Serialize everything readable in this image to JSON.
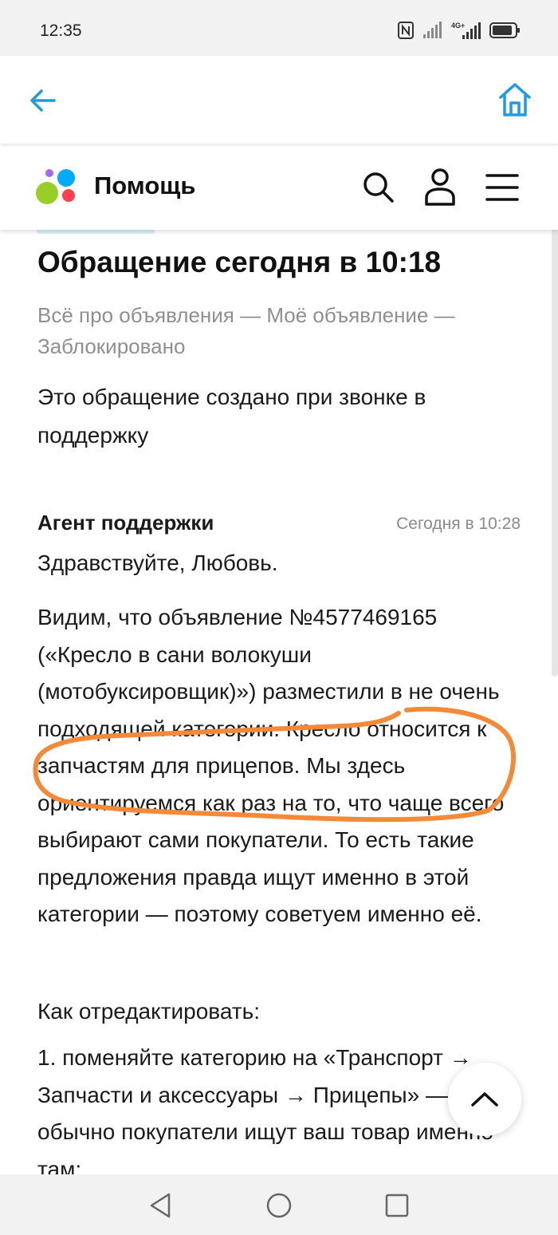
{
  "status": {
    "time": "12:35",
    "network": "4G+",
    "icons": [
      "nfc-icon",
      "signal-icon",
      "signal-4g-icon",
      "battery-icon"
    ]
  },
  "browser": {
    "back_icon": "arrow-left-icon",
    "home_icon": "home-icon",
    "accent": "#1e9be0"
  },
  "header": {
    "title": "Помощь",
    "icons": [
      "search-icon",
      "user-icon",
      "menu-icon"
    ],
    "logo_colors": [
      "#97cf26",
      "#a169f7",
      "#00aaff",
      "#ff4053"
    ]
  },
  "appeal": {
    "title": "Обращение сегодня в 10:18",
    "breadcrumb": "Всё про объявления — Моё объявление — Заблокировано",
    "note": "Это обращение создано при звонке в поддержку"
  },
  "message": {
    "author": "Агент поддержки",
    "time": "Сегодня в 10:28",
    "greeting": "Здравствуйте, Любовь.",
    "body": "Видим, что объявление №4577469165 («Кресло в сани волокуши (мотобуксировщик)») разместили в не очень подходящей категории. Кресло относится к запчастям для прицепов. Мы здесь ориентируемся как раз на то, что чаще всего выбирают сами покупатели. То есть такие предложения правда ищут именно в этой категории — поэтому советуем именно её.",
    "how_to": "Как отредактировать:",
    "step1": "1. поменяйте категорию на «Транспорт → Запчасти и аксессуары → Прицепы» — обычно покупатели ищут ваш товар именно там;"
  },
  "annotation_color": "#f28a3a",
  "scroll_top_icon": "chevron-up-icon",
  "nav": {
    "icons": [
      "nav-back-icon",
      "nav-home-icon",
      "nav-recent-icon"
    ]
  }
}
